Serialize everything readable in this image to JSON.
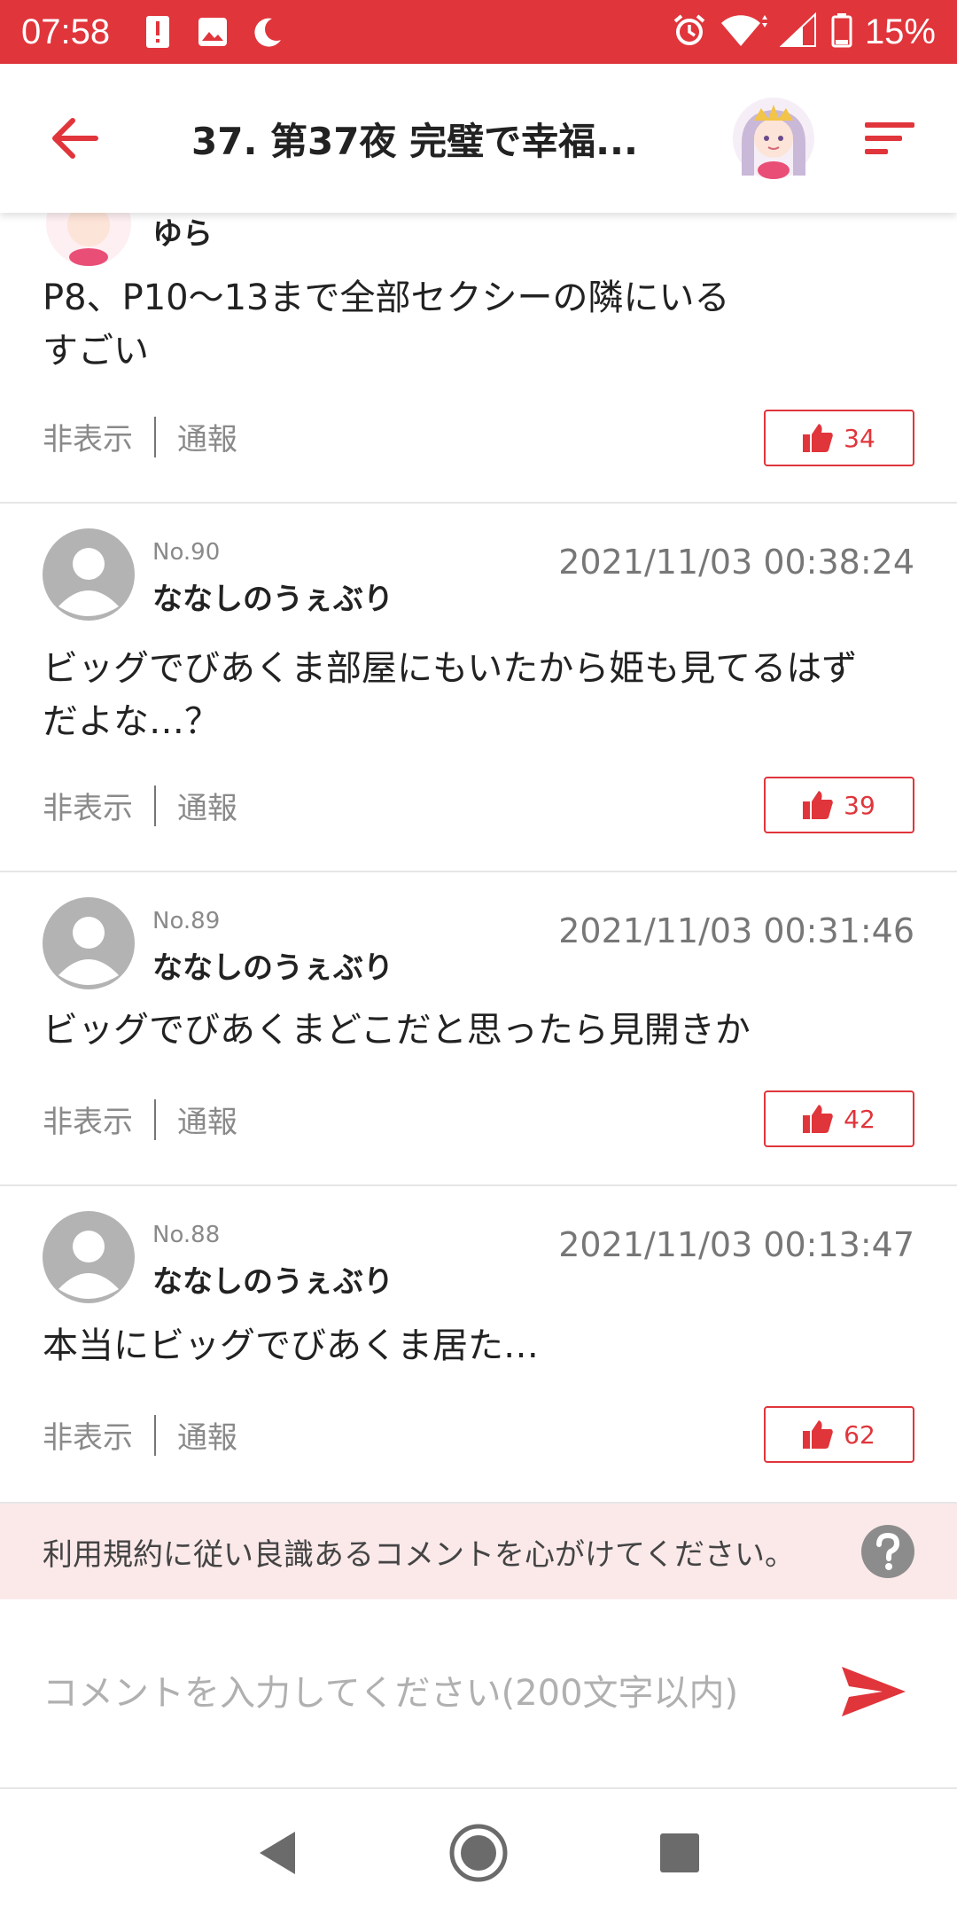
{
  "status": {
    "time": "07:58",
    "battery": "15%",
    "icons": [
      "alert-icon",
      "image-icon",
      "moon-icon",
      "alarm-icon",
      "wifi-icon",
      "signal-icon",
      "battery-icon"
    ]
  },
  "header": {
    "title": "37. 第37夜 完璧で幸福...",
    "back_icon": "arrow-left-icon",
    "menu_icon": "sort-icon"
  },
  "comments": [
    {
      "no": "",
      "name": "ゆら",
      "date": "",
      "text_lines": [
        "P8、P10～13まで全部セクシーの隣にいる",
        "すごい"
      ],
      "hide_label": "非表示",
      "report_label": "通報",
      "likes": "34"
    },
    {
      "no": "No.90",
      "name": "ななしのうぇぶり",
      "date": "2021/11/03 00:38:24",
      "text_lines": [
        "ビッグでびあくま部屋にもいたから姫も見てるはず",
        "だよな…？"
      ],
      "hide_label": "非表示",
      "report_label": "通報",
      "likes": "39"
    },
    {
      "no": "No.89",
      "name": "ななしのうぇぶり",
      "date": "2021/11/03 00:31:46",
      "text_lines": [
        "ビッグでびあくまどこだと思ったら見開きか"
      ],
      "hide_label": "非表示",
      "report_label": "通報",
      "likes": "42"
    },
    {
      "no": "No.88",
      "name": "ななしのうぇぶり",
      "date": "2021/11/03 00:13:47",
      "text_lines": [
        "本当にビッグでびあくま居た…"
      ],
      "hide_label": "非表示",
      "report_label": "通報",
      "likes": "62"
    }
  ],
  "notice": {
    "text": "利用規約に従い良識あるコメントを心がけてください。"
  },
  "input": {
    "placeholder": "コメントを入力してください(200文字以内)"
  },
  "colors": {
    "accent": "#e0353b",
    "notice_bg": "#fbe9ea"
  }
}
